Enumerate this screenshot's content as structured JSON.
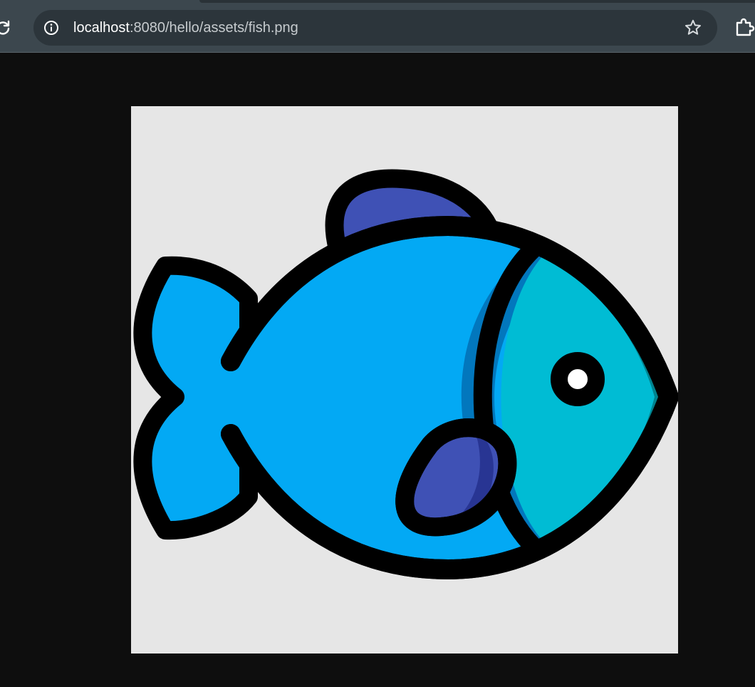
{
  "browser": {
    "address_bar": {
      "host": "localhost",
      "rest": ":8080/hello/assets/fish.png"
    },
    "icons": {
      "reload": "reload-icon",
      "site_info": "info-icon",
      "bookmark": "star-icon",
      "extensions": "puzzle-icon"
    }
  },
  "image": {
    "subject": "fish",
    "colors": {
      "background": "#e6e6e6",
      "body": "#03a9f4",
      "head": "#00bcd4",
      "head_shadow": "#00838f",
      "body_shadow": "#0277bd",
      "fins": "#3f51b5",
      "fin_shadow": "#283593",
      "outline": "#000000",
      "eye_highlight": "#ffffff"
    }
  }
}
